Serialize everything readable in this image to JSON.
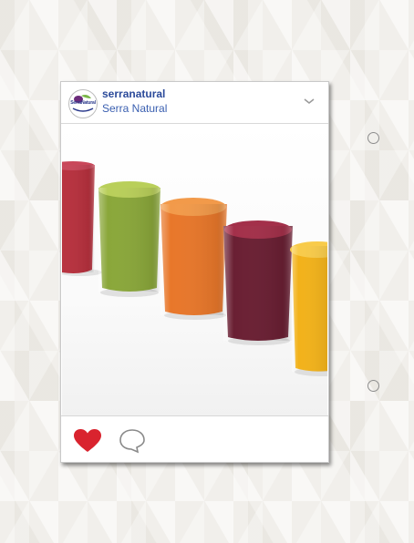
{
  "post": {
    "username": "serranatural",
    "display_name": "Serra Natural",
    "avatar_logo_text": "SerraNatural",
    "image_description": "row of fruit and vegetable juice glasses",
    "liked": true
  },
  "icons": {
    "menu": "chevron-down-icon",
    "like": "heart-icon",
    "comment": "comment-icon"
  },
  "colors": {
    "username": "#2b4a9a",
    "like": "#d9232e"
  }
}
